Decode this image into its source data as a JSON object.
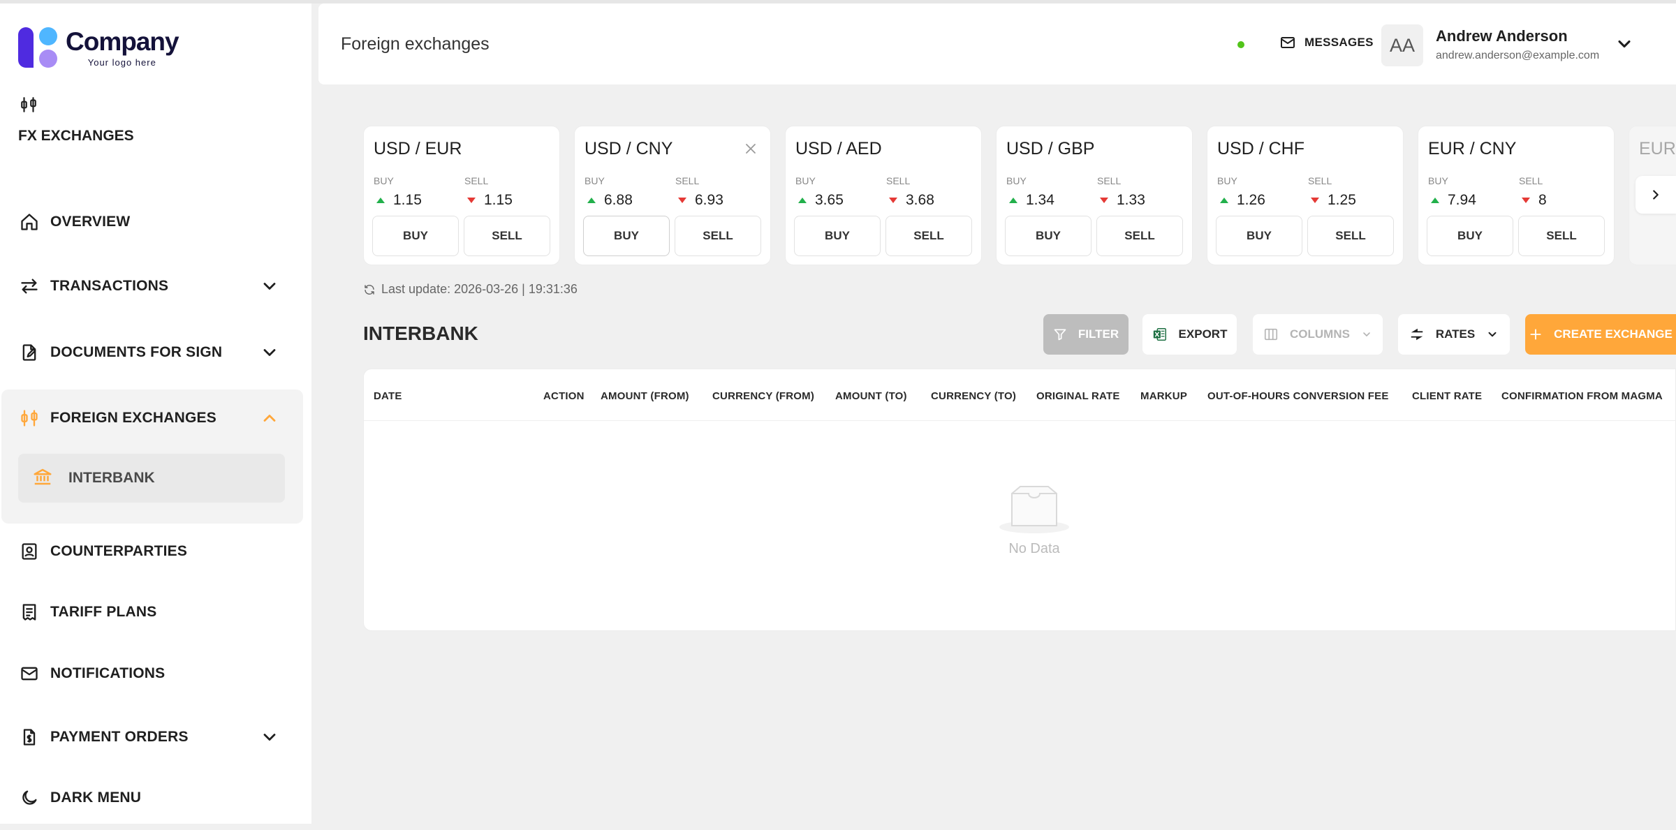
{
  "brand": {
    "name": "Company",
    "tagline": "Your logo here"
  },
  "sidebar": {
    "section_title": "FX EXCHANGES",
    "items": [
      {
        "label": "OVERVIEW",
        "icon": "home-icon"
      },
      {
        "label": "TRANSACTIONS",
        "icon": "transfer-arrows-icon",
        "expandable": true
      },
      {
        "label": "DOCUMENTS FOR SIGN",
        "icon": "document-sign-icon",
        "expandable": true
      },
      {
        "label": "FOREIGN EXCHANGES",
        "icon": "exchange-icon",
        "expandable": true,
        "expanded": true,
        "children": [
          {
            "label": "INTERBANK",
            "icon": "bank-icon",
            "active": true
          }
        ]
      },
      {
        "label": "COUNTERPARTIES",
        "icon": "contact-card-icon"
      },
      {
        "label": "TARIFF PLANS",
        "icon": "receipt-icon"
      },
      {
        "label": "NOTIFICATIONS",
        "icon": "envelope-icon"
      },
      {
        "label": "PAYMENT ORDERS",
        "icon": "payment-doc-icon",
        "expandable": true
      },
      {
        "label": "DARK MENU",
        "icon": "moon-icon"
      }
    ]
  },
  "header": {
    "title": "Foreign exchanges",
    "messages_label": "MESSAGES",
    "user": {
      "initials": "AA",
      "name": "Andrew Anderson",
      "email": "andrew.anderson@example.com"
    }
  },
  "fx_cards": {
    "buy_label": "BUY",
    "sell_label": "SELL",
    "buy_button": "BUY",
    "sell_button": "SELL",
    "items": [
      {
        "pair": "USD / EUR",
        "buy": "1.15",
        "sell": "1.15"
      },
      {
        "pair": "USD / CNY",
        "buy": "6.88",
        "sell": "6.93"
      },
      {
        "pair": "USD / AED",
        "buy": "3.65",
        "sell": "3.68"
      },
      {
        "pair": "USD / GBP",
        "buy": "1.34",
        "sell": "1.33"
      },
      {
        "pair": "USD / CHF",
        "buy": "1.26",
        "sell": "1.25"
      },
      {
        "pair": "EUR / CNY",
        "buy": "7.94",
        "sell": "8"
      },
      {
        "pair": "EUR"
      }
    ],
    "last_update": "Last update: 2026-03-26 | 19:31:36"
  },
  "interbank": {
    "title": "INTERBANK",
    "toolbar": {
      "filter": "FILTER",
      "export": "EXPORT",
      "columns": "COLUMNS",
      "rates": "RATES",
      "create": "CREATE EXCHANGE"
    },
    "columns": [
      "DATE",
      "ACTION",
      "AMOUNT (FROM)",
      "CURRENCY (FROM)",
      "AMOUNT (TO)",
      "CURRENCY (TO)",
      "ORIGINAL RATE",
      "MARKUP",
      "OUT-OF-HOURS CONVERSION FEE",
      "CLIENT RATE",
      "CONFIRMATION FROM MAGMA"
    ],
    "empty_text": "No Data"
  },
  "colors": {
    "accent": "#ffa73a",
    "brand_primary": "#4f2be0",
    "up": "#22b04b",
    "down": "#e53935",
    "status_online": "#52c41a"
  }
}
